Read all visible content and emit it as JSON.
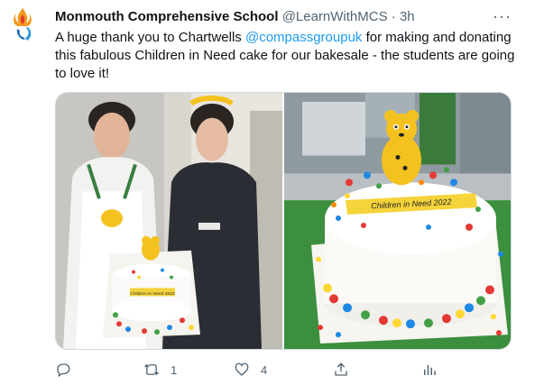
{
  "tweet": {
    "author": "Monmouth Comprehensive School",
    "handle": "@LearnWithMCS",
    "separator": "·",
    "time": "3h",
    "more": "···",
    "text_before": "A huge thank you to Chartwells ",
    "mention": "@compassgroupuk",
    "text_after": " for making and donating this fabulous Children in Need cake for our bakesale - the students are going to love it!"
  },
  "media": {
    "left_photo": "photo-staff-holding-cake",
    "right_photo": "photo-cake-closeup",
    "cake_banner_text": "Children in Need 2022",
    "cake_banner_small": "Children in Need 2022"
  },
  "actions": {
    "reply_icon": "reply-icon",
    "retweet_icon": "retweet-icon",
    "retweet_count": "1",
    "like_icon": "heart-icon",
    "like_count": "4",
    "share_icon": "share-icon",
    "analytics_icon": "analytics-icon"
  },
  "colors": {
    "text": "#0f1419",
    "secondary": "#536471",
    "link": "#1d9bf0"
  }
}
